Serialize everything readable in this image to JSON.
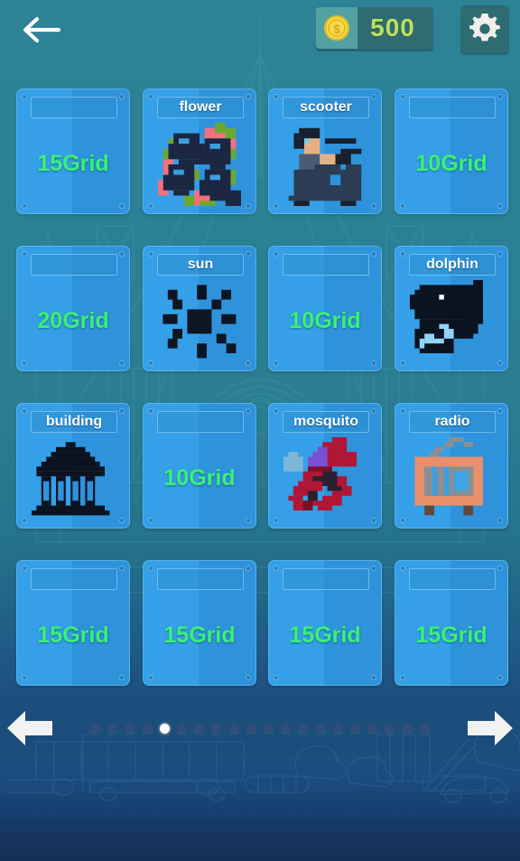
{
  "topbar": {
    "back_icon": "arrow-left-icon",
    "coin_icon": "gold-coin-icon",
    "coin_amount": "500",
    "settings_icon": "gear-icon"
  },
  "grid": {
    "rows": [
      [
        {
          "title": "",
          "locked": true,
          "grid_label": "15Grid",
          "art": "none"
        },
        {
          "title": "flower",
          "locked": false,
          "grid_label": "",
          "art": "flower"
        },
        {
          "title": "scooter",
          "locked": false,
          "grid_label": "",
          "art": "scooter"
        },
        {
          "title": "",
          "locked": true,
          "grid_label": "10Grid",
          "art": "none"
        }
      ],
      [
        {
          "title": "",
          "locked": true,
          "grid_label": "20Grid",
          "art": "none"
        },
        {
          "title": "sun",
          "locked": false,
          "grid_label": "",
          "art": "sun"
        },
        {
          "title": "",
          "locked": true,
          "grid_label": "10Grid",
          "art": "none"
        },
        {
          "title": "dolphin",
          "locked": false,
          "grid_label": "",
          "art": "dolphin"
        }
      ],
      [
        {
          "title": "building",
          "locked": false,
          "grid_label": "",
          "art": "building"
        },
        {
          "title": "",
          "locked": true,
          "grid_label": "10Grid",
          "art": "none"
        },
        {
          "title": "mosquito",
          "locked": false,
          "grid_label": "",
          "art": "mosquito"
        },
        {
          "title": "radio",
          "locked": false,
          "grid_label": "",
          "art": "radio"
        }
      ],
      [
        {
          "title": "",
          "locked": true,
          "grid_label": "15Grid",
          "art": "none"
        },
        {
          "title": "",
          "locked": true,
          "grid_label": "15Grid",
          "art": "none"
        },
        {
          "title": "",
          "locked": true,
          "grid_label": "15Grid",
          "art": "none"
        },
        {
          "title": "",
          "locked": true,
          "grid_label": "15Grid",
          "art": "none"
        }
      ]
    ]
  },
  "nav": {
    "prev_icon": "arrow-left-icon",
    "next_icon": "arrow-right-icon",
    "page_count": 20,
    "active_page": 5
  },
  "colors": {
    "background_top": "#2d8295",
    "background_bottom": "#143055",
    "card_face": "#35a0e8",
    "card_face_shade": "#2e93db",
    "grid_label": "#3bf07a",
    "coin_text": "#b9e05a",
    "coin_gold": "#f2d13c",
    "panel": "#2f6b72",
    "dot_inactive": "#2f4f78",
    "dot_active": "#ffffff"
  }
}
